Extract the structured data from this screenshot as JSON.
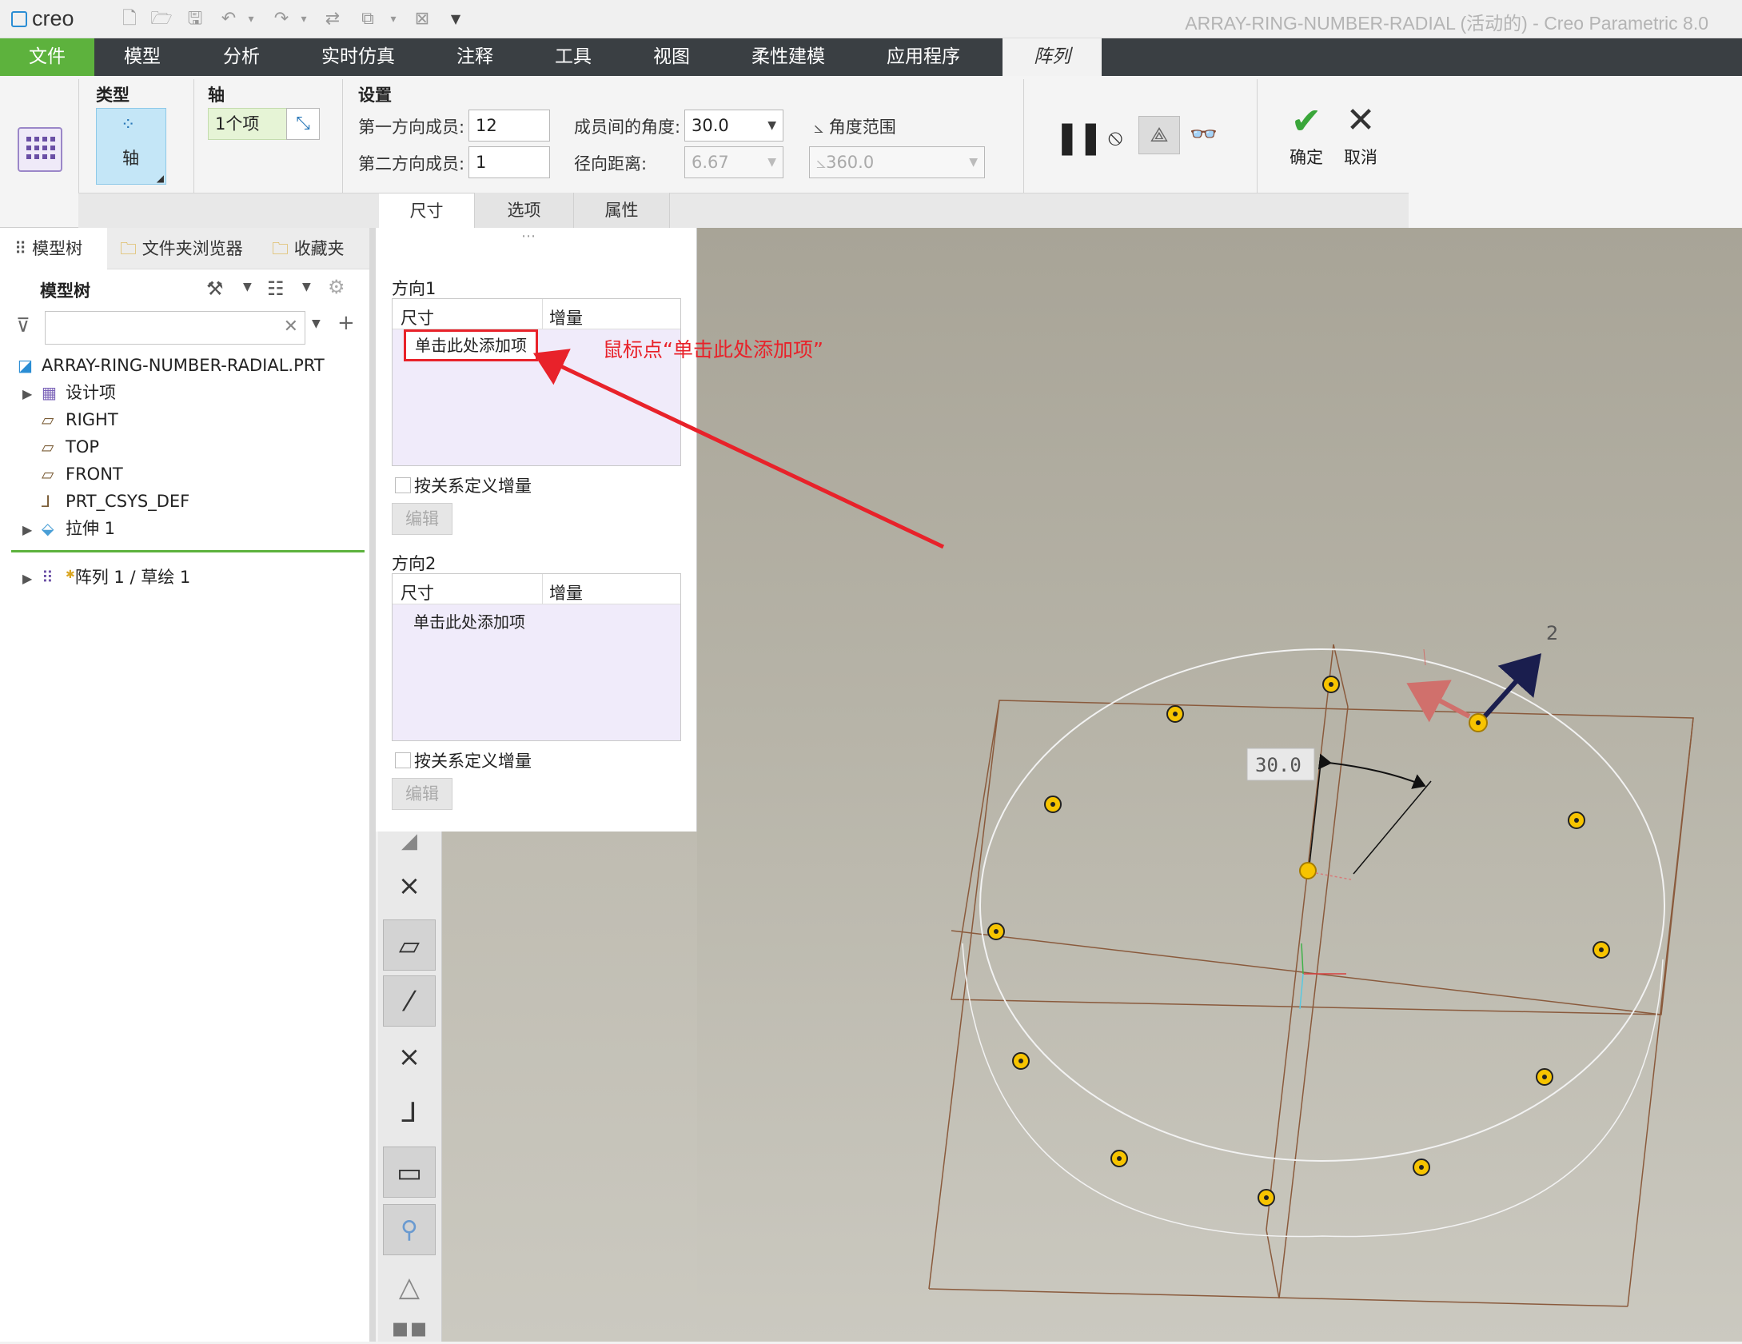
{
  "app": {
    "logo": "creo",
    "window_title": "ARRAY-RING-NUMBER-RADIAL (活动的) - Creo Parametric 8.0"
  },
  "menu": {
    "items": [
      "文件",
      "模型",
      "分析",
      "实时仿真",
      "注释",
      "工具",
      "视图",
      "柔性建模",
      "应用程序",
      "阵列"
    ]
  },
  "ribbon": {
    "type_label": "类型",
    "type_value": "轴",
    "axis_label": "轴",
    "axis_value": "1个项",
    "settings_label": "设置",
    "dir1_members_label": "第一方向成员:",
    "dir1_members_value": "12",
    "dir2_members_label": "第二方向成员:",
    "dir2_members_value": "1",
    "angle_between_label": "成员间的角度:",
    "angle_between_value": "30.0",
    "radial_distance_label": "径向距离:",
    "radial_distance_value": "6.67",
    "angle_range_label": "角度范围",
    "angle_range_value": "360.0",
    "ok_label": "确定",
    "cancel_label": "取消",
    "tabs": [
      "尺寸",
      "选项",
      "属性"
    ]
  },
  "left_pane": {
    "tabs": [
      "模型树",
      "文件夹浏览器",
      "收藏夹"
    ],
    "tree_title": "模型树",
    "tree": [
      {
        "label": "ARRAY-RING-NUMBER-RADIAL.PRT",
        "icon": "part-icon"
      },
      {
        "label": "设计项",
        "icon": "design-items-icon"
      },
      {
        "label": "RIGHT",
        "icon": "datum-plane-icon"
      },
      {
        "label": "TOP",
        "icon": "datum-plane-icon"
      },
      {
        "label": "FRONT",
        "icon": "datum-plane-icon"
      },
      {
        "label": "PRT_CSYS_DEF",
        "icon": "csys-icon"
      },
      {
        "label": "拉伸 1",
        "icon": "extrude-icon"
      },
      {
        "label": "阵列 1 / 草绘 1",
        "icon": "pattern-icon"
      }
    ]
  },
  "dim_panel": {
    "dir1_title": "方向1",
    "dir2_title": "方向2",
    "col_dimension": "尺寸",
    "col_increment": "增量",
    "add_item": "单击此处添加项",
    "relation_checkbox": "按关系定义增量",
    "edit_button": "编辑"
  },
  "annotation": {
    "text": "鼠标点“单击此处添加项”"
  },
  "viewport": {
    "angle_dim": "30.0",
    "direction_label": "2"
  },
  "colors": {
    "accent_green": "#5db23d",
    "menu_dark": "#3a3f43",
    "annotation_red": "#e8222a",
    "sketch_brown": "#8a5a3c"
  }
}
